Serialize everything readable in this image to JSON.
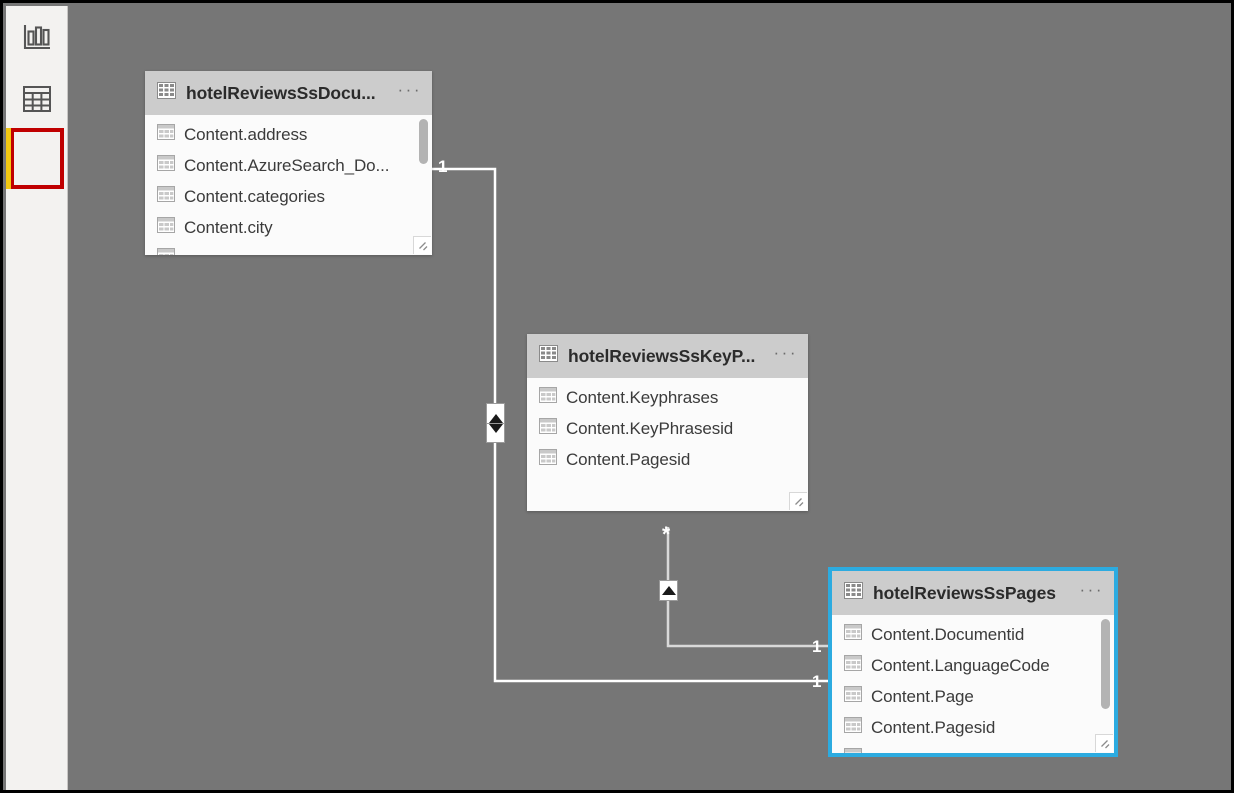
{
  "view_rail": {
    "items": [
      {
        "name": "report-view",
        "icon": "bar-chart-icon",
        "selected": false
      },
      {
        "name": "data-view",
        "icon": "grid-table-icon",
        "selected": false
      },
      {
        "name": "model-view",
        "icon": "model-relationship-icon",
        "selected": true
      }
    ],
    "selection_highlight_color": "#c00000",
    "accent_color": "#f2c811"
  },
  "canvas": {
    "background_color": "#767676",
    "selected_card_border_color": "#2cabe0"
  },
  "tables": [
    {
      "id": "documents",
      "title": "hotelReviewsSsDocu...",
      "menu": "···",
      "selected": false,
      "has_scrollbar": true,
      "fields": [
        "Content.address",
        "Content.AzureSearch_Do...",
        "Content.categories",
        "Content.city"
      ]
    },
    {
      "id": "keyphrases",
      "title": "hotelReviewsSsKeyP...",
      "menu": "···",
      "selected": false,
      "has_scrollbar": false,
      "fields": [
        "Content.Keyphrases",
        "Content.KeyPhrasesid",
        "Content.Pagesid"
      ]
    },
    {
      "id": "pages",
      "title": "hotelReviewsSsPages",
      "menu": "···",
      "selected": true,
      "has_scrollbar": true,
      "fields": [
        "Content.Documentid",
        "Content.LanguageCode",
        "Content.Page",
        "Content.Pagesid"
      ]
    }
  ],
  "relationships": [
    {
      "id": "documents-to-pages",
      "from_label": "1",
      "to_label": "1",
      "cross_filter": "both",
      "marker": "bidirectional-arrows"
    },
    {
      "id": "keyphrases-to-pages",
      "from_label": "*",
      "to_label": "1",
      "cross_filter": "single",
      "marker": "single-arrow-up"
    }
  ],
  "labels": {
    "one_top": "1",
    "star_middle": "*",
    "one_pages_upper": "1",
    "one_pages_lower": "1"
  }
}
